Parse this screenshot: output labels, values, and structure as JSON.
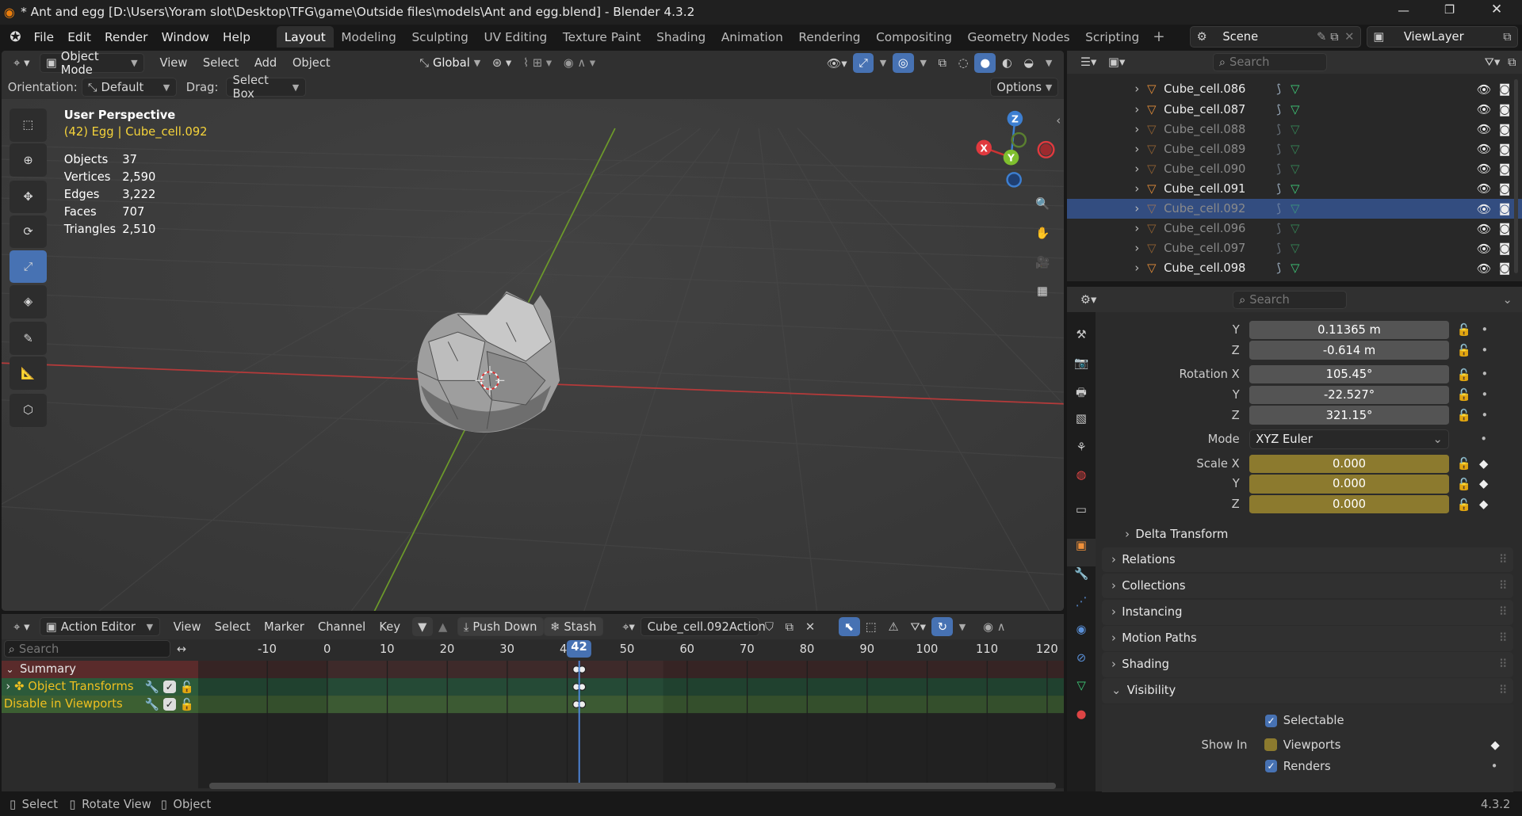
{
  "window": {
    "title": "* Ant and egg [D:\\Users\\Yoram slot\\Desktop\\TFG\\game\\Outside files\\models\\Ant and egg.blend] - Blender 4.3.2",
    "version": "4.3.2"
  },
  "menu": [
    "File",
    "Edit",
    "Render",
    "Window",
    "Help"
  ],
  "workspaces": [
    "Layout",
    "Modeling",
    "Sculpting",
    "UV Editing",
    "Texture Paint",
    "Shading",
    "Animation",
    "Rendering",
    "Compositing",
    "Geometry Nodes",
    "Scripting"
  ],
  "scene": "Scene",
  "viewlayer": "ViewLayer",
  "viewport": {
    "mode": "Object Mode",
    "menus": [
      "View",
      "Select",
      "Add",
      "Object"
    ],
    "transform": "Global",
    "orientation_label": "Orientation:",
    "orientation": "Default",
    "drag_label": "Drag:",
    "drag": "Select Box",
    "options": "Options",
    "perspective": "User Perspective",
    "context_frame": "(42) Egg",
    "context_object": "Cube_cell.092",
    "stats": [
      {
        "k": "Objects",
        "v": "37"
      },
      {
        "k": "Vertices",
        "v": "2,590"
      },
      {
        "k": "Edges",
        "v": "3,222"
      },
      {
        "k": "Faces",
        "v": "707"
      },
      {
        "k": "Triangles",
        "v": "2,510"
      }
    ],
    "gizmo": {
      "x": "X",
      "y": "Y",
      "z": "Z"
    }
  },
  "outliner": {
    "search": "Search",
    "rows": [
      {
        "name": "Cube_cell.086",
        "dim": false,
        "sel": false
      },
      {
        "name": "Cube_cell.087",
        "dim": false,
        "sel": false
      },
      {
        "name": "Cube_cell.088",
        "dim": true,
        "sel": false
      },
      {
        "name": "Cube_cell.089",
        "dim": true,
        "sel": false
      },
      {
        "name": "Cube_cell.090",
        "dim": true,
        "sel": false
      },
      {
        "name": "Cube_cell.091",
        "dim": false,
        "sel": false
      },
      {
        "name": "Cube_cell.092",
        "dim": true,
        "sel": true
      },
      {
        "name": "Cube_cell.096",
        "dim": true,
        "sel": false
      },
      {
        "name": "Cube_cell.097",
        "dim": true,
        "sel": false
      },
      {
        "name": "Cube_cell.098",
        "dim": false,
        "sel": false
      }
    ]
  },
  "properties": {
    "search": "Search",
    "loc_y": "0.11365 m",
    "loc_z": "-0.614 m",
    "rotation_label": "Rotation X",
    "rot_x": "105.45°",
    "rot_y": "-22.527°",
    "rot_z": "321.15°",
    "mode_label": "Mode",
    "mode": "XYZ Euler",
    "scale_label": "Scale X",
    "scale_x": "0.000",
    "scale_y": "0.000",
    "scale_z": "0.000",
    "y": "Y",
    "z": "Z",
    "delta": "Delta Transform",
    "panels": [
      "Relations",
      "Collections",
      "Instancing",
      "Motion Paths",
      "Shading"
    ],
    "visibility": "Visibility",
    "selectable": "Selectable",
    "show_in": "Show In",
    "viewports": "Viewports",
    "renders": "Renders"
  },
  "action_editor": {
    "mode": "Action Editor",
    "menus": [
      "View",
      "Select",
      "Marker",
      "Channel",
      "Key"
    ],
    "push_down": "Push Down",
    "stash": "Stash",
    "action": "Cube_cell.092Action",
    "search": "Search",
    "current_frame": "42",
    "ticks": [
      "-10",
      "0",
      "10",
      "20",
      "30",
      "40",
      "50",
      "60",
      "70",
      "80",
      "90",
      "100",
      "110",
      "120"
    ],
    "channels": [
      {
        "name": "Summary"
      },
      {
        "name": "Object Transforms"
      },
      {
        "name": "Disable in Viewports"
      }
    ]
  },
  "status": [
    {
      "label": "Select"
    },
    {
      "label": "Rotate View"
    },
    {
      "label": "Object"
    }
  ]
}
